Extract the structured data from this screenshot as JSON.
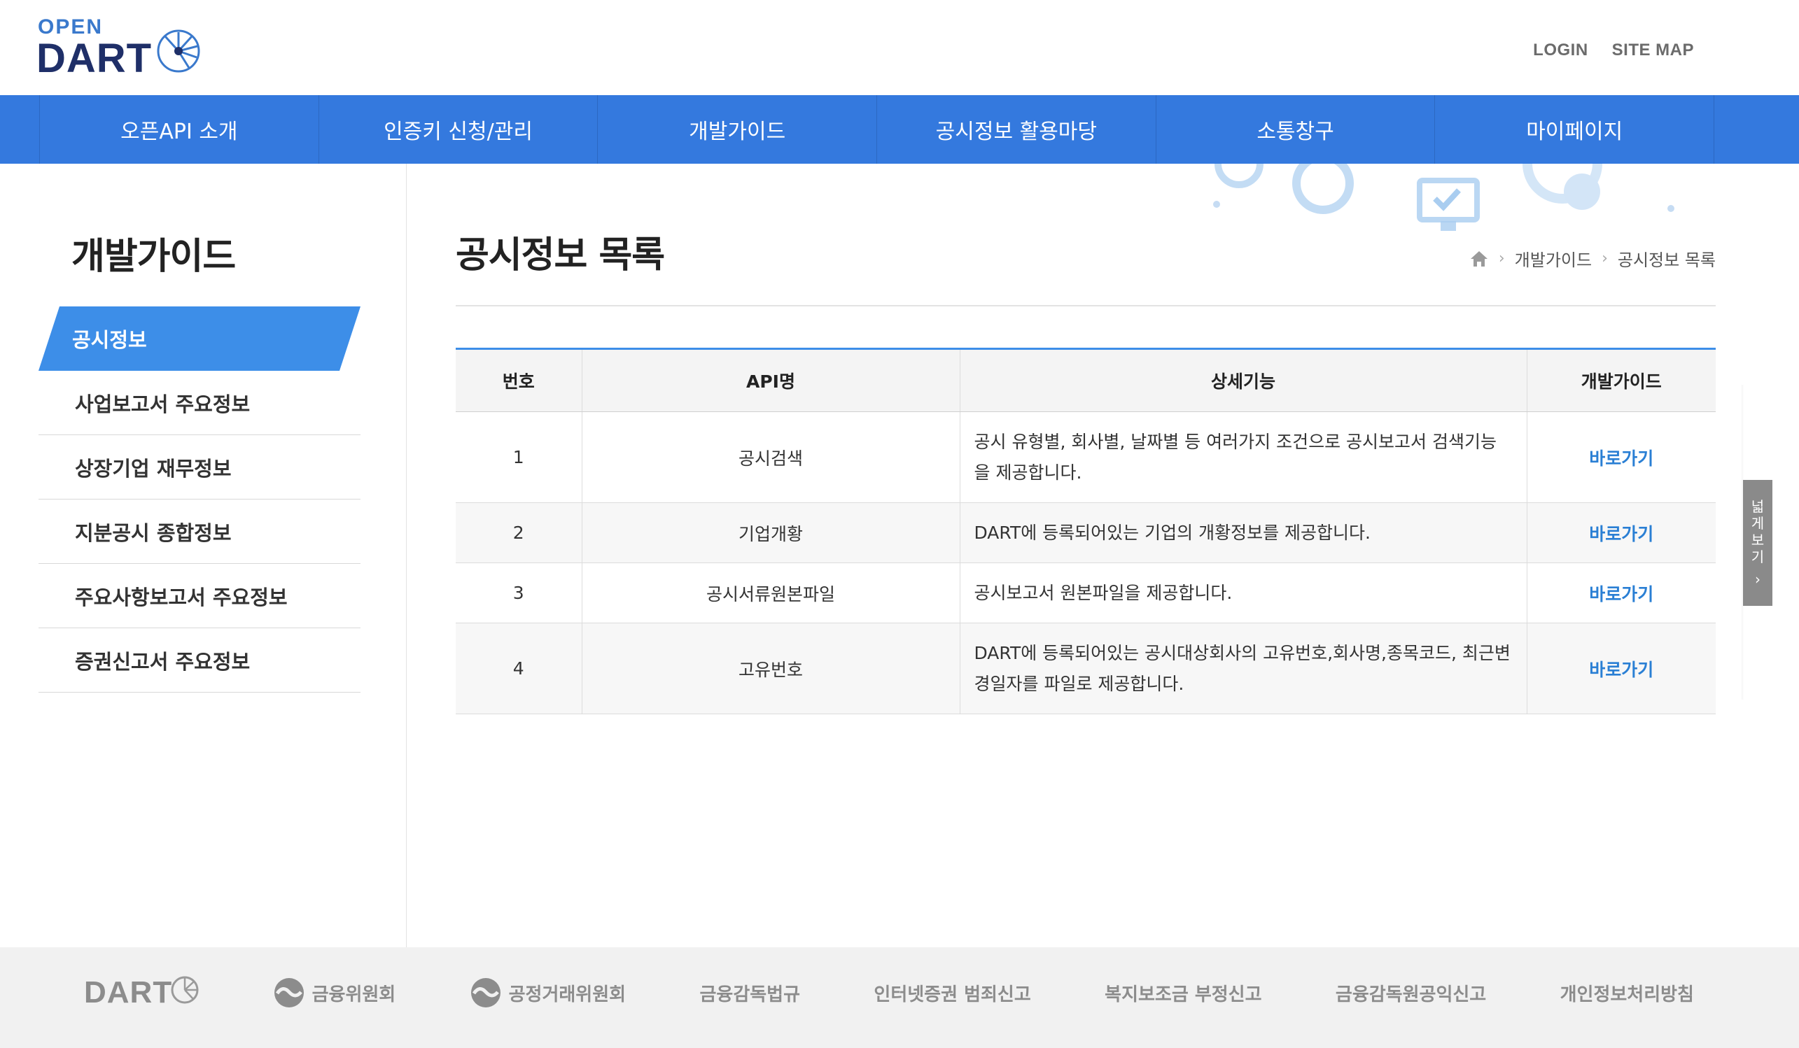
{
  "logo": {
    "open": "OPEN",
    "dart": "DART"
  },
  "util": {
    "login": "LOGIN",
    "sitemap": "SITE MAP"
  },
  "gnb": [
    "오픈API 소개",
    "인증키 신청/관리",
    "개발가이드",
    "공시정보 활용마당",
    "소통창구",
    "마이페이지"
  ],
  "sidebar": {
    "title": "개발가이드",
    "items": [
      "공시정보",
      "사업보고서 주요정보",
      "상장기업 재무정보",
      "지분공시 종합정보",
      "주요사항보고서 주요정보",
      "증권신고서 주요정보"
    ]
  },
  "page": {
    "title": "공시정보 목록",
    "breadcrumb": [
      "개발가이드",
      "공시정보 목록"
    ]
  },
  "table": {
    "headers": [
      "번호",
      "API명",
      "상세기능",
      "개발가이드"
    ],
    "rows": [
      {
        "no": "1",
        "api": "공시검색",
        "desc": "공시 유형별, 회사별, 날짜별 등 여러가지 조건으로 공시보고서 검색기능을 제공합니다.",
        "link": "바로가기"
      },
      {
        "no": "2",
        "api": "기업개황",
        "desc": "DART에 등록되어있는 기업의 개황정보를 제공합니다.",
        "link": "바로가기"
      },
      {
        "no": "3",
        "api": "공시서류원본파일",
        "desc": "공시보고서 원본파일을 제공합니다.",
        "link": "바로가기"
      },
      {
        "no": "4",
        "api": "고유번호",
        "desc": "DART에 등록되어있는 공시대상회사의 고유번호,회사명,종목코드, 최근변경일자를 파일로 제공합니다.",
        "link": "바로가기"
      }
    ]
  },
  "side_tab": {
    "label_chars": [
      "넓",
      "게",
      "보",
      "기"
    ],
    "arrow": "›"
  },
  "footer": {
    "dart": "DART",
    "links": [
      "금융위원회",
      "공정거래위원회",
      "금융감독법규",
      "인터넷증권 범죄신고",
      "복지보조금 부정신고",
      "금융감독원공익신고",
      "개인정보처리방침"
    ]
  },
  "colors": {
    "brand_blue": "#3479de",
    "active_blue": "#3d8ee8",
    "link_blue": "#2a7fd4",
    "logo_navy": "#1f2f68"
  }
}
